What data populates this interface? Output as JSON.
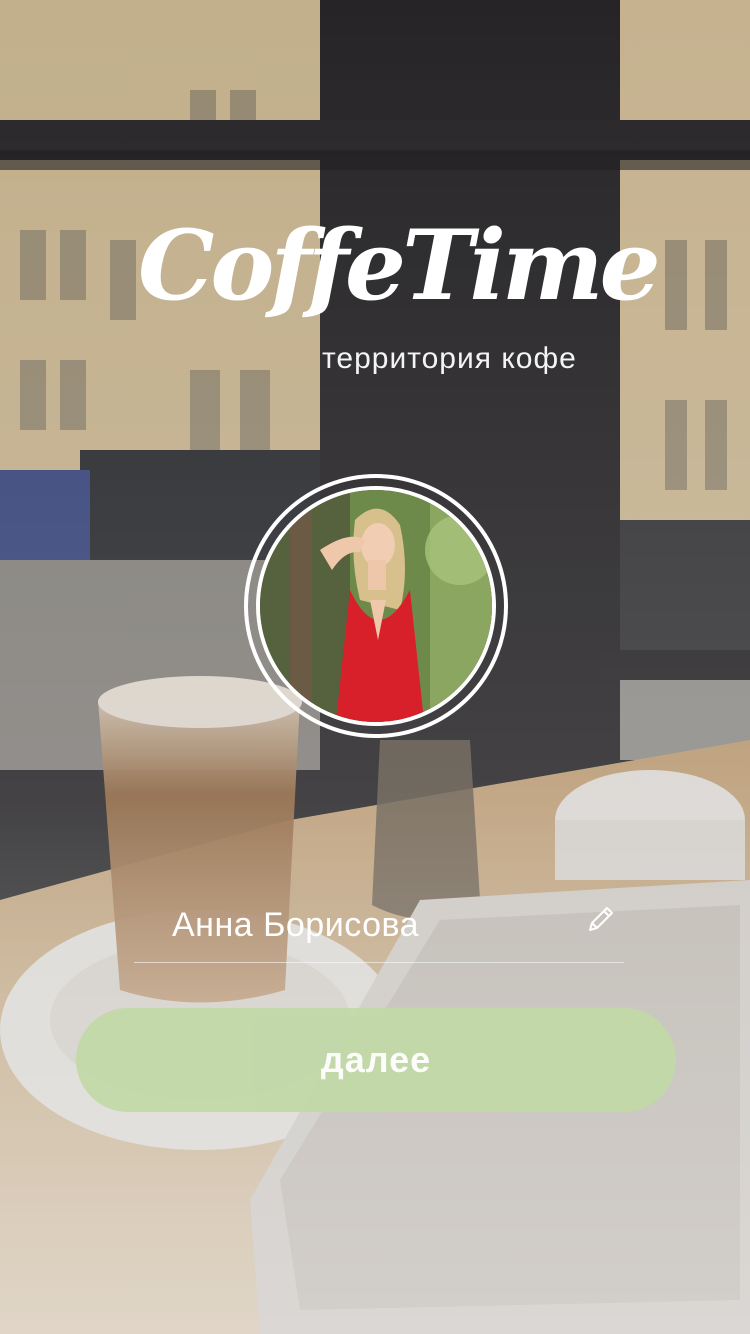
{
  "app": {
    "title": "CoffeTime",
    "subtitle": "территория кофе"
  },
  "profile": {
    "name": "Анна Борисова",
    "edit_icon": "pencil-icon"
  },
  "actions": {
    "next_label": "далее"
  },
  "colors": {
    "button_bg": "#c2d9a8",
    "text": "#ffffff"
  }
}
